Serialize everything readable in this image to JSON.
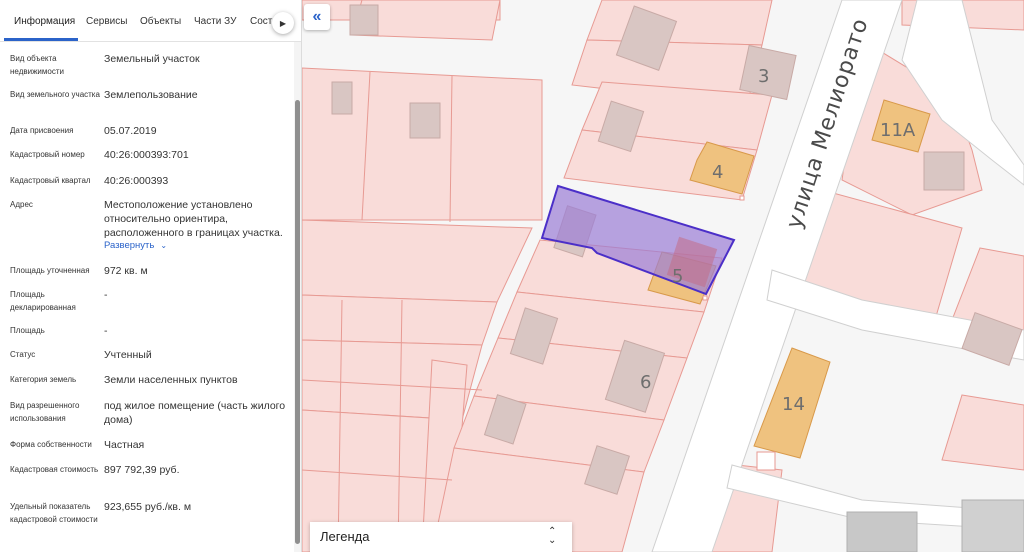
{
  "tabs": [
    {
      "label": "Информация",
      "active": true
    },
    {
      "label": "Сервисы"
    },
    {
      "label": "Объекты"
    },
    {
      "label": "Части ЗУ"
    },
    {
      "label": "Соста"
    }
  ],
  "rows": [
    {
      "label": "Вид объекта недвижимости",
      "value": "Земельный участок"
    },
    {
      "label": "Вид земельного участка",
      "value": "Землепользование"
    },
    {
      "label": "Дата присвоения",
      "value": "05.07.2019"
    },
    {
      "label": "Кадастровый номер",
      "value": "40:26:000393:701"
    },
    {
      "label": "Кадастровый квартал",
      "value": "40:26:000393"
    },
    {
      "label": "Адрес",
      "value": "Местоположение установлено относительно ориентира, расположенного в границах участка."
    },
    {
      "label": "Площадь уточненная",
      "value": "972 кв. м"
    },
    {
      "label": "Площадь декларированная",
      "value": "-"
    },
    {
      "label": "Площадь",
      "value": "-"
    },
    {
      "label": "Статус",
      "value": "Учтенный"
    },
    {
      "label": "Категория земель",
      "value": "Земли населенных пунктов"
    },
    {
      "label": "Вид разрешенного использования",
      "value": "под жилое помещение (часть жилого дома)"
    },
    {
      "label": "Форма собственности",
      "value": "Частная"
    },
    {
      "label": "Кадастровая стоимость",
      "value": "897 792,39 руб."
    },
    {
      "label": "Удельный показатель кадастровой стоимости",
      "value": "923,655 руб./кв. м"
    }
  ],
  "address_expand": "Развернуть",
  "map": {
    "street_name": "улица Мелиорато",
    "house_numbers": [
      "3",
      "4",
      "11А",
      "5",
      "6",
      "14"
    ],
    "colors": {
      "parcel_fill": "#f9dcd9",
      "parcel_border": "#e79a93",
      "building_gray": "#d9c6c3",
      "building_orange": "#efc27f",
      "selected_fill": "#9b7ed6",
      "selected_border": "#4b2fc8",
      "road": "#ffffff"
    }
  },
  "legend": {
    "label": "Легенда"
  }
}
